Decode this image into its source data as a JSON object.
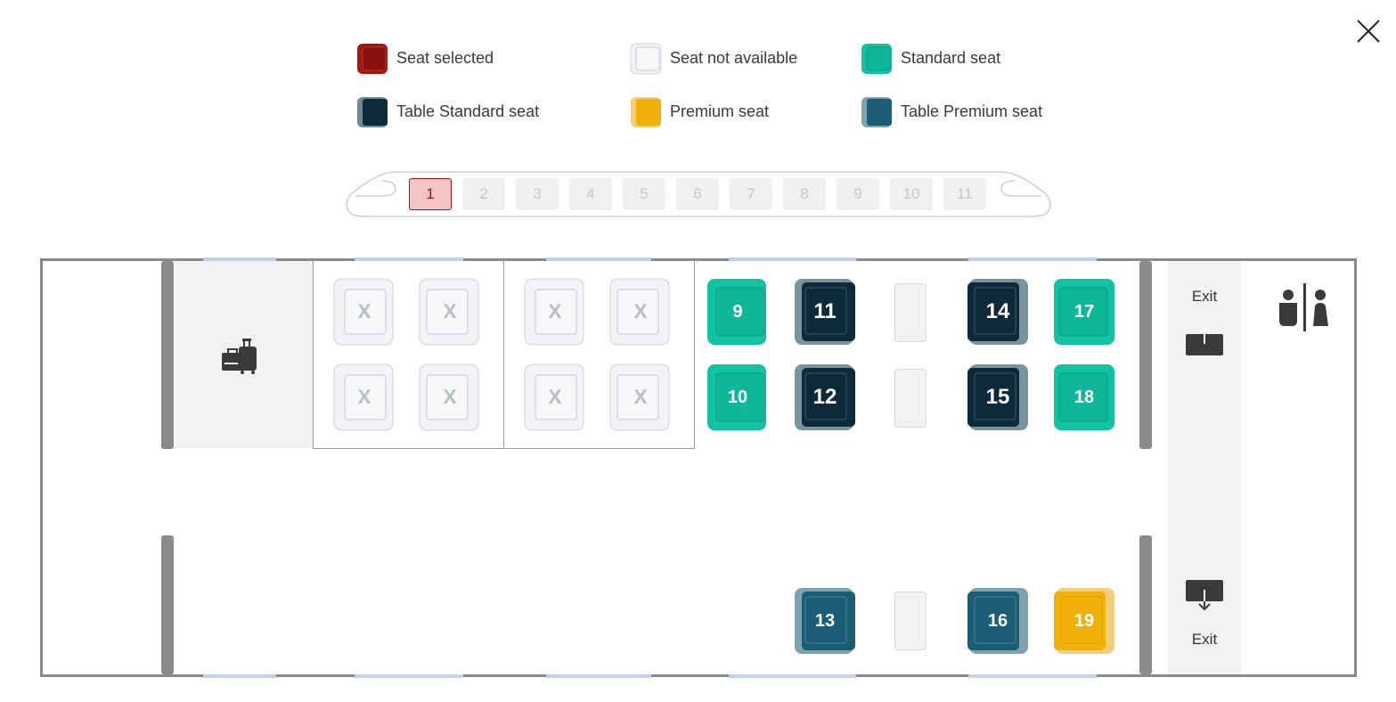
{
  "legend": [
    {
      "label": "Seat selected",
      "type": "selected"
    },
    {
      "label": "Seat not available",
      "type": "unavailable"
    },
    {
      "label": "Standard seat",
      "type": "standard"
    },
    {
      "label": "Table Standard seat",
      "type": "table-standard"
    },
    {
      "label": "Premium seat",
      "type": "premium"
    },
    {
      "label": "Table Premium seat",
      "type": "table-premium"
    }
  ],
  "coaches": [
    "1",
    "2",
    "3",
    "4",
    "5",
    "6",
    "7",
    "8",
    "9",
    "10",
    "11"
  ],
  "selected_coach": "1",
  "exit_top_label": "Exit",
  "exit_bottom_label": "Exit",
  "seat_unavailable_mark": "X",
  "seats": [
    {
      "num": "9",
      "type": "standard"
    },
    {
      "num": "10",
      "type": "standard"
    },
    {
      "num": "11",
      "type": "table-standard"
    },
    {
      "num": "12",
      "type": "table-standard"
    },
    {
      "num": "13",
      "type": "table-premium"
    },
    {
      "num": "14",
      "type": "table-standard"
    },
    {
      "num": "15",
      "type": "table-standard"
    },
    {
      "num": "16",
      "type": "table-premium"
    },
    {
      "num": "17",
      "type": "standard"
    },
    {
      "num": "18",
      "type": "standard"
    },
    {
      "num": "19",
      "type": "premium"
    }
  ],
  "colors": {
    "selected": "#a3170f",
    "standard": "#12c2a4",
    "table_standard": "#0d2a3a",
    "premium": "#f0b007",
    "table_premium": "#1b5d75",
    "unavailable": "#f2f3f6"
  },
  "icons": [
    "close-icon",
    "luggage-icon",
    "exit-up-icon",
    "exit-down-icon",
    "toilet-icon"
  ]
}
